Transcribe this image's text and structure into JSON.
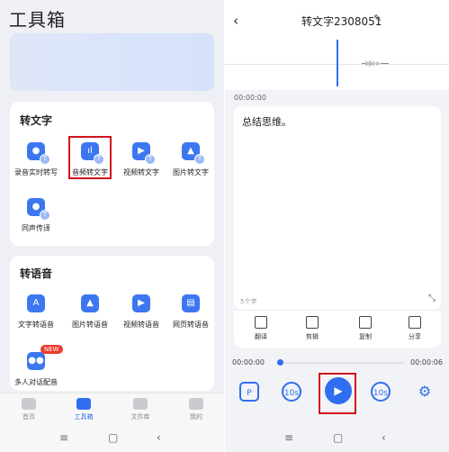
{
  "left": {
    "title": "工具箱",
    "section1": {
      "title": "转文字",
      "tools": [
        {
          "label": "录音实时转写",
          "icon": "microphone-icon"
        },
        {
          "label": "音频转文字",
          "icon": "audio-wave-icon"
        },
        {
          "label": "视频转文字",
          "icon": "video-icon"
        },
        {
          "label": "图片转文字",
          "icon": "image-icon"
        },
        {
          "label": "同声传译",
          "icon": "person-translate-icon"
        }
      ],
      "badge": "T"
    },
    "section2": {
      "title": "转语音",
      "tools": [
        {
          "label": "文字转语音",
          "icon": "text-a-icon"
        },
        {
          "label": "图片转语音",
          "icon": "image-icon"
        },
        {
          "label": "视频转语音",
          "icon": "video-icon"
        },
        {
          "label": "网页转语音",
          "icon": "webpage-icon"
        },
        {
          "label": "多人对话配音",
          "icon": "people-icon"
        }
      ],
      "new_badge": "NEW"
    },
    "tabs": [
      {
        "label": "首页",
        "icon": "home-icon"
      },
      {
        "label": "工具箱",
        "icon": "toolbox-icon",
        "active": true
      },
      {
        "label": "文件库",
        "icon": "folder-icon"
      },
      {
        "label": "我的",
        "icon": "profile-icon"
      }
    ],
    "accent": "#2f6ef0",
    "highlight": "#d0131b"
  },
  "right": {
    "title": "转文字2308051",
    "start_time": "00:00:00",
    "content": "总结思维。",
    "char_count": "5个字",
    "actions": [
      {
        "label": "翻译",
        "icon": "translate-icon"
      },
      {
        "label": "剪辑",
        "icon": "cut-icon"
      },
      {
        "label": "复制",
        "icon": "copy-icon"
      },
      {
        "label": "分享",
        "icon": "share-icon"
      }
    ],
    "current_time": "00:00:00",
    "duration": "00:00:06",
    "progress": 0,
    "rewind_label": "10s",
    "forward_label": "10s"
  },
  "nav": {
    "menu": "≡",
    "home": "▢",
    "back": "‹"
  }
}
